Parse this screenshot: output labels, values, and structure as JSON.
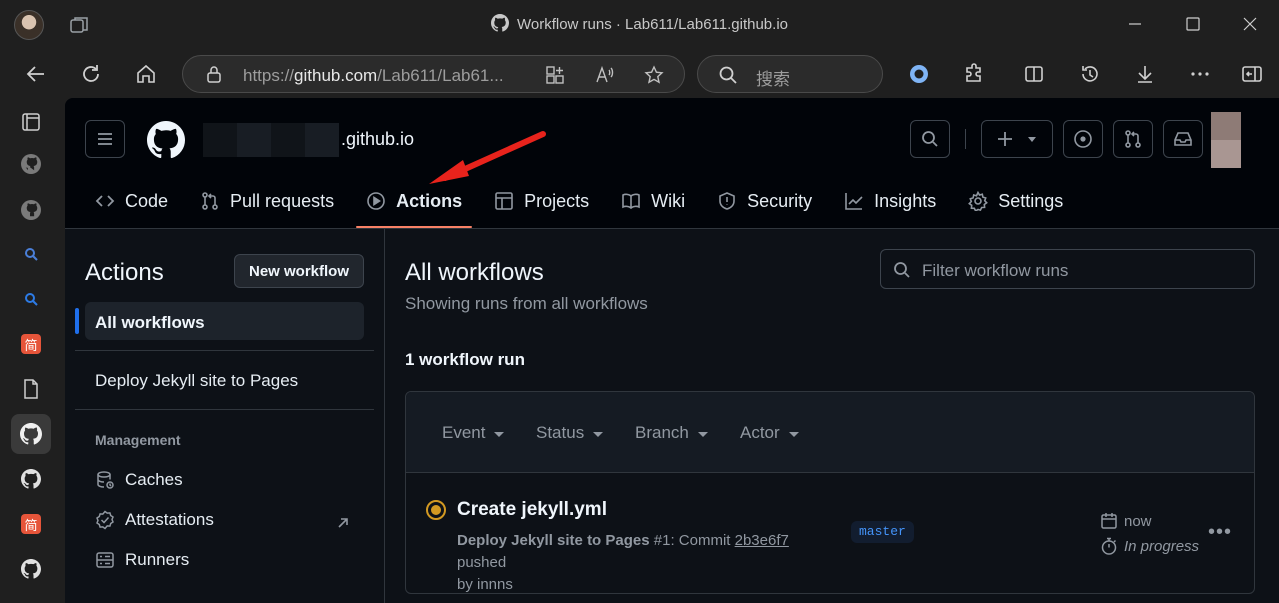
{
  "browser": {
    "window_title": "Workflow runs · Lab611/Lab611.github.io",
    "url_prefix": "https://",
    "url_host": "github.com",
    "url_path": "/Lab611/Lab61...",
    "search_placeholder": "搜索"
  },
  "sidebar": {
    "items": [
      {
        "icon": "tab-icon"
      },
      {
        "icon": "github-icon"
      },
      {
        "icon": "github-icon"
      },
      {
        "icon": "search-icon"
      },
      {
        "icon": "search-icon"
      },
      {
        "icon": "jianshu-icon",
        "label": "简"
      },
      {
        "icon": "document-icon"
      },
      {
        "icon": "github-icon",
        "active": true
      },
      {
        "icon": "github-icon"
      },
      {
        "icon": "jianshu-icon",
        "label": "简"
      },
      {
        "icon": "github-icon"
      }
    ]
  },
  "repo": {
    "name_suffix": ".github.io"
  },
  "nav": {
    "tabs": [
      {
        "label": "Code",
        "icon": "code-icon"
      },
      {
        "label": "Pull requests",
        "icon": "pull-request-icon"
      },
      {
        "label": "Actions",
        "icon": "play-icon",
        "selected": true
      },
      {
        "label": "Projects",
        "icon": "table-icon"
      },
      {
        "label": "Wiki",
        "icon": "book-icon"
      },
      {
        "label": "Security",
        "icon": "shield-icon"
      },
      {
        "label": "Insights",
        "icon": "graph-icon"
      },
      {
        "label": "Settings",
        "icon": "gear-icon"
      }
    ]
  },
  "left_pane": {
    "title": "Actions",
    "new_workflow_label": "New workflow",
    "all_workflows_label": "All workflows",
    "workflows": [
      "Deploy Jekyll site to Pages"
    ],
    "management_heading": "Management",
    "management_items": [
      {
        "label": "Caches",
        "icon": "database-icon"
      },
      {
        "label": "Attestations",
        "icon": "verified-icon"
      },
      {
        "label": "Runners",
        "icon": "server-icon"
      }
    ]
  },
  "main": {
    "title": "All workflows",
    "subtitle": "Showing runs from all workflows",
    "filter_placeholder": "Filter workflow runs",
    "run_count": "1 workflow run",
    "filters": [
      "Event",
      "Status",
      "Branch",
      "Actor"
    ],
    "runs": [
      {
        "title": "Create jekyll.yml",
        "workflow": "Deploy Jekyll site to Pages",
        "run_number": "#1",
        "commit_text": ": Commit ",
        "sha": "2b3e6f7",
        "pushed_text": " pushed",
        "by_text": "by innns",
        "branch": "master",
        "time": "now",
        "status": "In progress"
      }
    ]
  },
  "colors": {
    "accent_underline": "#f78166",
    "status_in_progress": "#d29922",
    "branch_text": "#4493f8",
    "annotation_arrow": "#e8231c"
  }
}
